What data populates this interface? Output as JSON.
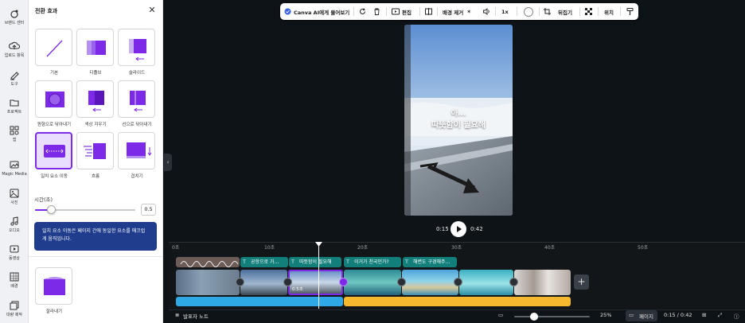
{
  "rail": {
    "items": [
      {
        "label": "브랜드 센터",
        "icon": "brand-icon"
      },
      {
        "label": "업로드 항목",
        "icon": "upload-cloud-icon"
      },
      {
        "label": "도구",
        "icon": "draw-tool-icon"
      },
      {
        "label": "프로젝트",
        "icon": "folder-icon"
      },
      {
        "label": "앱",
        "icon": "apps-icon"
      },
      {
        "label": "Magic Media",
        "icon": "magic-media-icon"
      },
      {
        "label": "사진",
        "icon": "photo-icon"
      },
      {
        "label": "오디오",
        "icon": "music-note-icon"
      },
      {
        "label": "동영상",
        "icon": "video-icon"
      },
      {
        "label": "배경",
        "icon": "background-icon"
      },
      {
        "label": "대량 제작",
        "icon": "bulk-create-icon"
      }
    ]
  },
  "panel": {
    "title": "전환 효과",
    "transitions": [
      {
        "label": "기본"
      },
      {
        "label": "디졸브"
      },
      {
        "label": "슬라이드"
      },
      {
        "label": "원형으로 닦아내기"
      },
      {
        "label": "색상 지우기"
      },
      {
        "label": "선으로 닦아내기"
      },
      {
        "label": "일치 요소 이동",
        "selected": true
      },
      {
        "label": "흐름"
      },
      {
        "label": "겹치기"
      }
    ],
    "duration_label": "시간(초)",
    "duration_value": "0.5",
    "duration_fraction": 0.16,
    "info_text": "일치 요소 이동은 페이지 간에 동일한 요소를 매끄럽게 움직입니다.",
    "extra_label": "잘라내기"
  },
  "toolbar": {
    "ask_canva": "Canva AI에게 물어보기",
    "edit": "편집",
    "bg_remove": "배경 제거",
    "speed": "1x",
    "flip": "뒤집기",
    "position": "위치"
  },
  "video": {
    "caption_line1": "아...",
    "caption_line2": "따뜻함이 필요해"
  },
  "player": {
    "current": "0:15",
    "total": "0:42"
  },
  "timeline": {
    "ruler": [
      "0초",
      "10초",
      "20초",
      "30초",
      "40초",
      "50초"
    ],
    "text_items": [
      "공항으로 가...",
      "따뜻함이 필요해",
      "이거가 천국인가?",
      "해변도 구경해주..."
    ],
    "clip_duration": "0.5초"
  },
  "bottom": {
    "notes": "발표자 노트",
    "zoom": "25%",
    "page": "페이지",
    "time": "0:15 / 0:42"
  },
  "colors": {
    "accent": "#7d2ae8",
    "info_bg": "#1f3d8c",
    "text_track": "#127f7b",
    "audio_blue": "#2fa9e6",
    "audio_yellow": "#f5b82e"
  }
}
